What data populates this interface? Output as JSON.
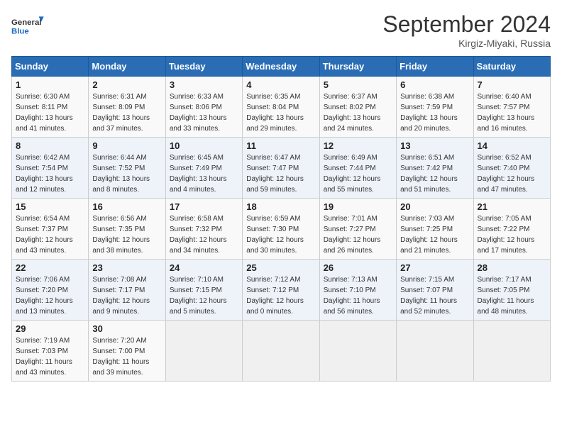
{
  "header": {
    "logo_line1": "General",
    "logo_line2": "Blue",
    "month": "September 2024",
    "location": "Kirgiz-Miyaki, Russia"
  },
  "weekdays": [
    "Sunday",
    "Monday",
    "Tuesday",
    "Wednesday",
    "Thursday",
    "Friday",
    "Saturday"
  ],
  "weeks": [
    [
      {
        "day": 1,
        "sunrise": "6:30 AM",
        "sunset": "8:11 PM",
        "daylight": "13 hours and 41 minutes."
      },
      {
        "day": 2,
        "sunrise": "6:31 AM",
        "sunset": "8:09 PM",
        "daylight": "13 hours and 37 minutes."
      },
      {
        "day": 3,
        "sunrise": "6:33 AM",
        "sunset": "8:06 PM",
        "daylight": "13 hours and 33 minutes."
      },
      {
        "day": 4,
        "sunrise": "6:35 AM",
        "sunset": "8:04 PM",
        "daylight": "13 hours and 29 minutes."
      },
      {
        "day": 5,
        "sunrise": "6:37 AM",
        "sunset": "8:02 PM",
        "daylight": "13 hours and 24 minutes."
      },
      {
        "day": 6,
        "sunrise": "6:38 AM",
        "sunset": "7:59 PM",
        "daylight": "13 hours and 20 minutes."
      },
      {
        "day": 7,
        "sunrise": "6:40 AM",
        "sunset": "7:57 PM",
        "daylight": "13 hours and 16 minutes."
      }
    ],
    [
      {
        "day": 8,
        "sunrise": "6:42 AM",
        "sunset": "7:54 PM",
        "daylight": "13 hours and 12 minutes."
      },
      {
        "day": 9,
        "sunrise": "6:44 AM",
        "sunset": "7:52 PM",
        "daylight": "13 hours and 8 minutes."
      },
      {
        "day": 10,
        "sunrise": "6:45 AM",
        "sunset": "7:49 PM",
        "daylight": "13 hours and 4 minutes."
      },
      {
        "day": 11,
        "sunrise": "6:47 AM",
        "sunset": "7:47 PM",
        "daylight": "12 hours and 59 minutes."
      },
      {
        "day": 12,
        "sunrise": "6:49 AM",
        "sunset": "7:44 PM",
        "daylight": "12 hours and 55 minutes."
      },
      {
        "day": 13,
        "sunrise": "6:51 AM",
        "sunset": "7:42 PM",
        "daylight": "12 hours and 51 minutes."
      },
      {
        "day": 14,
        "sunrise": "6:52 AM",
        "sunset": "7:40 PM",
        "daylight": "12 hours and 47 minutes."
      }
    ],
    [
      {
        "day": 15,
        "sunrise": "6:54 AM",
        "sunset": "7:37 PM",
        "daylight": "12 hours and 43 minutes."
      },
      {
        "day": 16,
        "sunrise": "6:56 AM",
        "sunset": "7:35 PM",
        "daylight": "12 hours and 38 minutes."
      },
      {
        "day": 17,
        "sunrise": "6:58 AM",
        "sunset": "7:32 PM",
        "daylight": "12 hours and 34 minutes."
      },
      {
        "day": 18,
        "sunrise": "6:59 AM",
        "sunset": "7:30 PM",
        "daylight": "12 hours and 30 minutes."
      },
      {
        "day": 19,
        "sunrise": "7:01 AM",
        "sunset": "7:27 PM",
        "daylight": "12 hours and 26 minutes."
      },
      {
        "day": 20,
        "sunrise": "7:03 AM",
        "sunset": "7:25 PM",
        "daylight": "12 hours and 21 minutes."
      },
      {
        "day": 21,
        "sunrise": "7:05 AM",
        "sunset": "7:22 PM",
        "daylight": "12 hours and 17 minutes."
      }
    ],
    [
      {
        "day": 22,
        "sunrise": "7:06 AM",
        "sunset": "7:20 PM",
        "daylight": "12 hours and 13 minutes."
      },
      {
        "day": 23,
        "sunrise": "7:08 AM",
        "sunset": "7:17 PM",
        "daylight": "12 hours and 9 minutes."
      },
      {
        "day": 24,
        "sunrise": "7:10 AM",
        "sunset": "7:15 PM",
        "daylight": "12 hours and 5 minutes."
      },
      {
        "day": 25,
        "sunrise": "7:12 AM",
        "sunset": "7:12 PM",
        "daylight": "12 hours and 0 minutes."
      },
      {
        "day": 26,
        "sunrise": "7:13 AM",
        "sunset": "7:10 PM",
        "daylight": "11 hours and 56 minutes."
      },
      {
        "day": 27,
        "sunrise": "7:15 AM",
        "sunset": "7:07 PM",
        "daylight": "11 hours and 52 minutes."
      },
      {
        "day": 28,
        "sunrise": "7:17 AM",
        "sunset": "7:05 PM",
        "daylight": "11 hours and 48 minutes."
      }
    ],
    [
      {
        "day": 29,
        "sunrise": "7:19 AM",
        "sunset": "7:03 PM",
        "daylight": "11 hours and 43 minutes."
      },
      {
        "day": 30,
        "sunrise": "7:20 AM",
        "sunset": "7:00 PM",
        "daylight": "11 hours and 39 minutes."
      },
      null,
      null,
      null,
      null,
      null
    ]
  ]
}
